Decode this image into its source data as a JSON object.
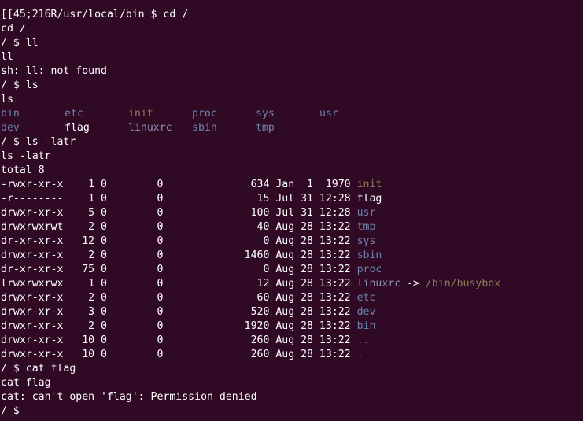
{
  "colors": {
    "background": "#300a24",
    "text": "#ffffff",
    "directory": "#6d83ad",
    "executable": "#8b7d5c",
    "symlink": "#8c8fb3"
  },
  "lines": {
    "l1": "[[45;216R/usr/local/bin $ cd /",
    "l2": "cd /",
    "l3": "/ $ ll",
    "l4": "ll",
    "l5": "sh: ll: not found",
    "l6": "/ $ ls",
    "l7": "ls",
    "l10": "/ $ ls -latr",
    "l11": "ls -latr",
    "l12": "total 8",
    "l26": "/ $ cat flag",
    "l27": "cat flag",
    "l28": "cat: can't open 'flag': Permission denied",
    "l29": "/ $ "
  },
  "ls_output": [
    {
      "name": "bin",
      "type": "dir"
    },
    {
      "name": "etc",
      "type": "dir"
    },
    {
      "name": "init",
      "type": "exec"
    },
    {
      "name": "proc",
      "type": "dir"
    },
    {
      "name": "sys",
      "type": "dir"
    },
    {
      "name": "usr",
      "type": "dir"
    },
    {
      "name": "dev",
      "type": "dir"
    },
    {
      "name": "flag",
      "type": "file"
    },
    {
      "name": "linuxrc",
      "type": "link"
    },
    {
      "name": "sbin",
      "type": "dir"
    },
    {
      "name": "tmp",
      "type": "dir"
    }
  ],
  "listing": [
    {
      "meta": "-rwxr-xr-x    1 0        0              634 Jan  1  1970 ",
      "name": "init",
      "type": "exec",
      "target": ""
    },
    {
      "meta": "-r--------    1 0        0               15 Jul 31 12:28 ",
      "name": "flag",
      "type": "file",
      "target": ""
    },
    {
      "meta": "drwxr-xr-x    5 0        0              100 Jul 31 12:28 ",
      "name": "usr",
      "type": "dir",
      "target": ""
    },
    {
      "meta": "drwxrwxrwt    2 0        0               40 Aug 28 13:22 ",
      "name": "tmp",
      "type": "dir",
      "target": ""
    },
    {
      "meta": "dr-xr-xr-x   12 0        0                0 Aug 28 13:22 ",
      "name": "sys",
      "type": "dir",
      "target": ""
    },
    {
      "meta": "drwxr-xr-x    2 0        0             1460 Aug 28 13:22 ",
      "name": "sbin",
      "type": "dir",
      "target": ""
    },
    {
      "meta": "dr-xr-xr-x   75 0        0                0 Aug 28 13:22 ",
      "name": "proc",
      "type": "dir",
      "target": ""
    },
    {
      "meta": "lrwxrwxrwx    1 0        0               12 Aug 28 13:22 ",
      "name": "linuxrc",
      "type": "link",
      "target": "/bin/busybox"
    },
    {
      "meta": "drwxr-xr-x    2 0        0               60 Aug 28 13:22 ",
      "name": "etc",
      "type": "dir",
      "target": ""
    },
    {
      "meta": "drwxr-xr-x    3 0        0              520 Aug 28 13:22 ",
      "name": "dev",
      "type": "dir",
      "target": ""
    },
    {
      "meta": "drwxr-xr-x    2 0        0             1920 Aug 28 13:22 ",
      "name": "bin",
      "type": "dir",
      "target": ""
    },
    {
      "meta": "drwxr-xr-x   10 0        0              260 Aug 28 13:22 ",
      "name": "..",
      "type": "dir",
      "target": ""
    },
    {
      "meta": "drwxr-xr-x   10 0        0              260 Aug 28 13:22 ",
      "name": ".",
      "type": "dir",
      "target": ""
    }
  ],
  "arrow": " -> "
}
